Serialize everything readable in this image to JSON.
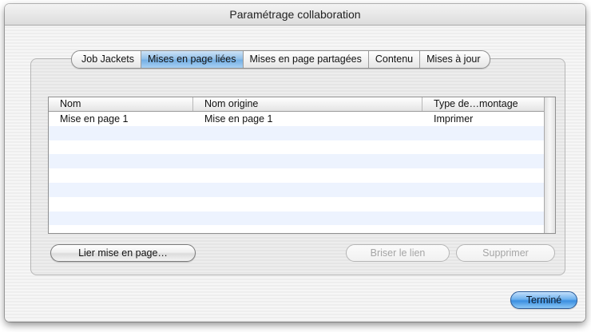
{
  "window": {
    "title": "Paramétrage collaboration"
  },
  "tabs": [
    {
      "label": "Job Jackets",
      "active": false
    },
    {
      "label": "Mises en page liées",
      "active": true
    },
    {
      "label": "Mises en page partagées",
      "active": false
    },
    {
      "label": "Contenu",
      "active": false
    },
    {
      "label": "Mises à jour",
      "active": false
    }
  ],
  "table": {
    "columns": [
      "Nom",
      "Nom origine",
      "Type de…montage"
    ],
    "rows": [
      [
        "Mise en page 1",
        "Mise en page 1",
        "Imprimer"
      ]
    ]
  },
  "buttons": {
    "link_layout": "Lier mise en page…",
    "break_link": "Briser le lien",
    "delete": "Supprimer",
    "done": "Terminé"
  },
  "colors": {
    "active_tab": "#8dbde8",
    "row_stripe": "#edf3fe",
    "primary_button": "#3a8fe0"
  }
}
